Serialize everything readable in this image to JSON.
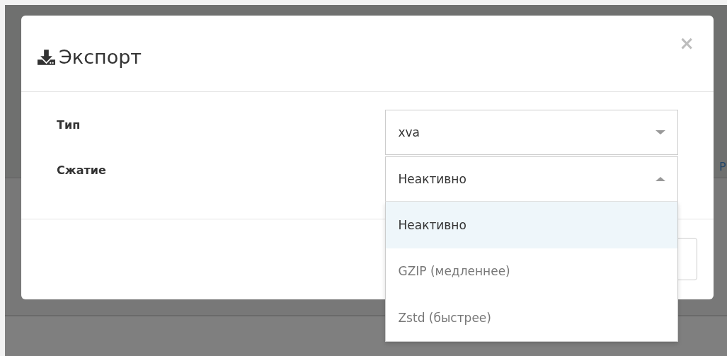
{
  "background": {
    "text_fragment": "Р"
  },
  "dialog": {
    "title": "Экспорт",
    "close": "×",
    "fields": [
      {
        "label": "Тип",
        "value": "xva",
        "open": false
      },
      {
        "label": "Сжатие",
        "value": "Неактивно",
        "open": true,
        "options": [
          {
            "label": "Неактивно",
            "selected": true
          },
          {
            "label": "GZIP (медленнее)",
            "selected": false
          },
          {
            "label": "Zstd (быстрее)",
            "selected": false
          }
        ]
      }
    ]
  }
}
